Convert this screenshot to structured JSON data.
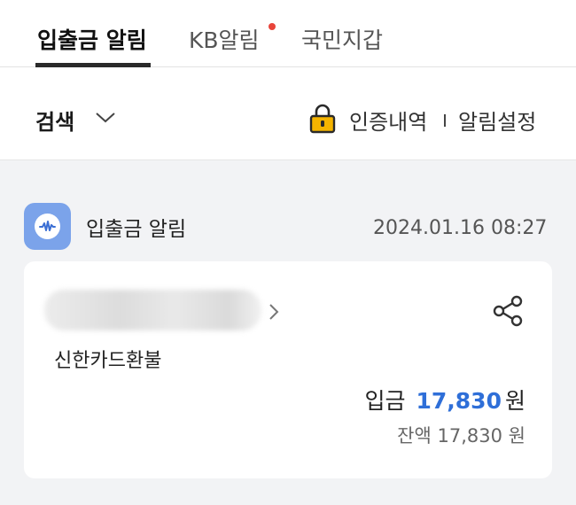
{
  "tabs": [
    {
      "label": "입출금 알림",
      "active": true
    },
    {
      "label": "KB알림",
      "has_new_dot": true
    },
    {
      "label": "국민지갑"
    }
  ],
  "toolbar": {
    "search_label": "검색",
    "auth_history": "인증내역",
    "notification_settings": "알림설정"
  },
  "notification": {
    "app_name": "입출금 알림",
    "timestamp": "2024.01.16 08:27",
    "memo": "신한카드환불",
    "deposit_label": "입금",
    "deposit_amount": "17,830",
    "currency": "원",
    "balance_label": "잔액",
    "balance_amount": "17,830"
  },
  "colors": {
    "accent_blue": "#2f6fd8",
    "notification_dot": "#e8443a",
    "lock_icon": "#f5b400",
    "app_icon_bg": "#7ba3ea"
  }
}
